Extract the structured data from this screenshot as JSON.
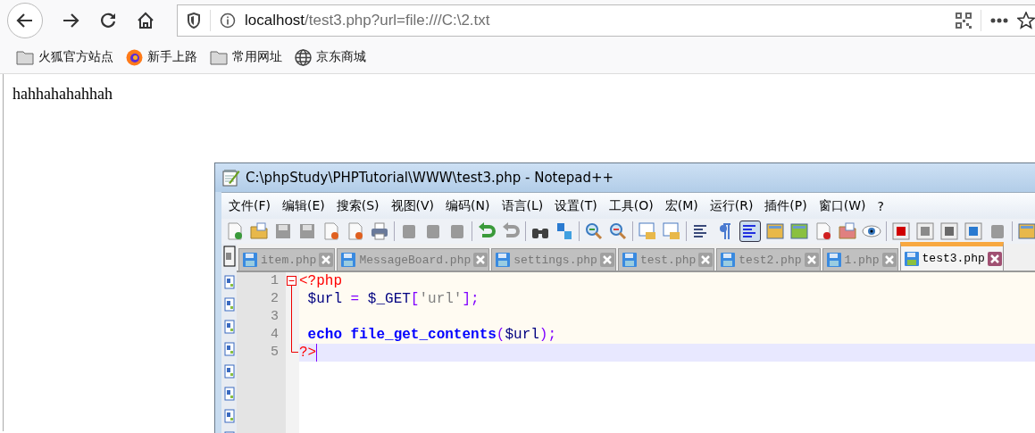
{
  "browser": {
    "url_host": "localhost",
    "url_path": "/test3.php?url=file:///C:\\2.txt",
    "bookmarks": [
      {
        "label": "火狐官方站点",
        "kind": "folder"
      },
      {
        "label": "新手上路",
        "kind": "logo"
      },
      {
        "label": "常用网址",
        "kind": "folder"
      },
      {
        "label": "京东商城",
        "kind": "globe"
      }
    ]
  },
  "page": {
    "text": "hahhahahahhah"
  },
  "editor": {
    "title": "C:\\phpStudy\\PHPTutorial\\WWW\\test3.php - Notepad++",
    "menu": [
      "文件(F)",
      "编辑(E)",
      "搜索(S)",
      "视图(V)",
      "编码(N)",
      "语言(L)",
      "设置(T)",
      "工具(O)",
      "宏(M)",
      "运行(R)",
      "插件(P)",
      "窗口(W)",
      "?"
    ],
    "tabs": [
      {
        "label": "item.php",
        "selected": false
      },
      {
        "label": "MessageBoard.php",
        "selected": false
      },
      {
        "label": "settings.php",
        "selected": false
      },
      {
        "label": "test.php",
        "selected": false
      },
      {
        "label": "test2.php",
        "selected": false
      },
      {
        "label": "1.php",
        "selected": false
      },
      {
        "label": "test3.php",
        "selected": true
      }
    ],
    "lines": [
      {
        "number": "1",
        "expanded": true,
        "current": false,
        "tokens": [
          {
            "text": "<?php",
            "kind": "delimiter"
          }
        ]
      },
      {
        "number": "2",
        "current": false,
        "tokens": [
          {
            "text": " $url",
            "kind": "variable"
          },
          {
            "text": " = ",
            "kind": "operator"
          },
          {
            "text": "$_GET",
            "kind": "variable"
          },
          {
            "text": "[",
            "kind": "operator"
          },
          {
            "text": "'url'",
            "kind": "string"
          },
          {
            "text": "];",
            "kind": "operator"
          }
        ]
      },
      {
        "number": "3",
        "current": false
      },
      {
        "number": "4",
        "current": false,
        "tokens": [
          {
            "text": " echo",
            "kind": "keyword"
          },
          {
            "text": " file_get_contents",
            "kind": "keyword"
          },
          {
            "text": "(",
            "kind": "operator"
          },
          {
            "text": "$url",
            "kind": "variable"
          },
          {
            "text": ");",
            "kind": "operator"
          }
        ]
      },
      {
        "number": "5",
        "current": true,
        "tokens": [
          {
            "text": "?>",
            "kind": "delimiter"
          }
        ]
      }
    ]
  }
}
